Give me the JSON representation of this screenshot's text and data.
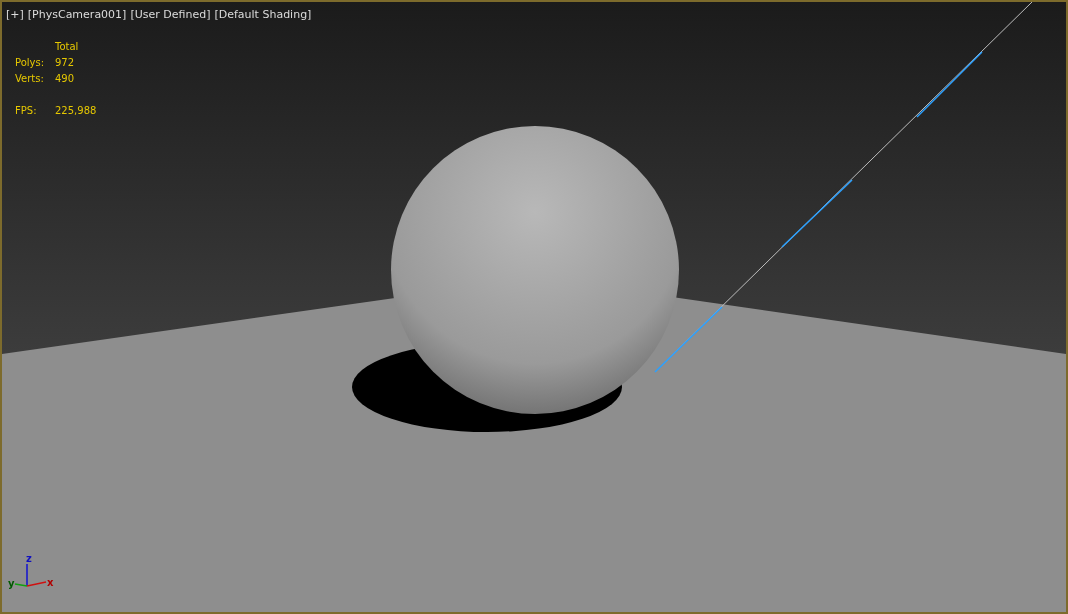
{
  "viewport": {
    "labels": [
      "[+]",
      "[PhysCamera001]",
      "[User Defined]",
      "[Default Shading]"
    ],
    "stats": {
      "header": "Total",
      "rows": [
        {
          "label": "Polys:",
          "value": "972"
        },
        {
          "label": "Verts:",
          "value": "490"
        }
      ],
      "fps": {
        "label": "FPS:",
        "value": "225,988"
      }
    },
    "axes": {
      "x": "x",
      "y": "y",
      "z": "z"
    }
  }
}
